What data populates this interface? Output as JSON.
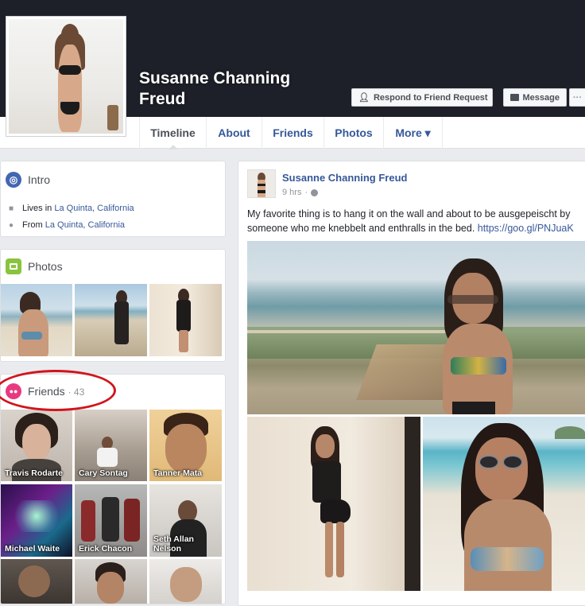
{
  "profile": {
    "name": "Susanne Channing Freud",
    "respond_label": "Respond to Friend Request",
    "message_label": "Message",
    "more_label": "···"
  },
  "nav": {
    "tabs": [
      {
        "label": "Timeline"
      },
      {
        "label": "About"
      },
      {
        "label": "Friends"
      },
      {
        "label": "Photos"
      },
      {
        "label": "More ▾"
      }
    ]
  },
  "intro": {
    "title": "Intro",
    "lives_prefix": "Lives in",
    "lives_place": "La Quinta, California",
    "from_prefix": "From",
    "from_place": "La Quinta, California"
  },
  "photos": {
    "title": "Photos"
  },
  "friends": {
    "title": "Friends",
    "count": "· 43",
    "list": [
      {
        "name": "Travis Rodarte"
      },
      {
        "name": "Cary Sontag"
      },
      {
        "name": "Tanner Mata"
      },
      {
        "name": "Michael Waite"
      },
      {
        "name": "Erick Chacon"
      },
      {
        "name": "Seth Allan Nelson"
      }
    ]
  },
  "post": {
    "author": "Susanne Channing Freud",
    "time": "9 hrs",
    "text": "My favorite thing is to hang it on the wall and about to be ausgepeischt by someone who me knebbelt and enthralls in the bed.",
    "link": "https://goo.gl/PNJuaK"
  },
  "colors": {
    "cover": "#1d2028",
    "link": "#365899",
    "background": "#e9ebee",
    "highlight_ring": "#d2141c",
    "intro_icon": "#4267b2",
    "photos_icon": "#8ac43f",
    "friends_icon": "#e8397f"
  }
}
